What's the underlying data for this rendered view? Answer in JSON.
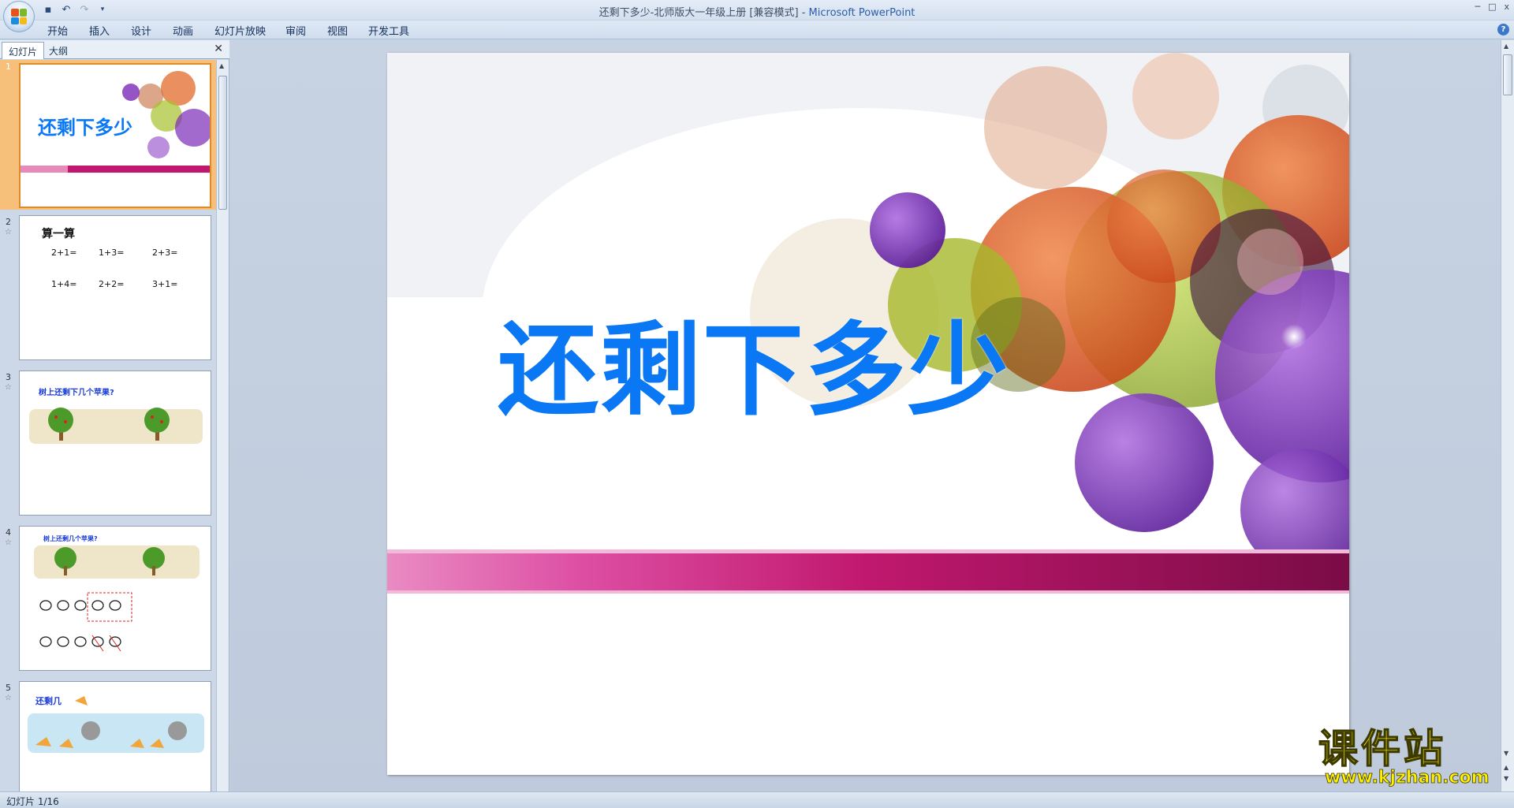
{
  "app": {
    "document_name": "还剩下多少-北师版大一年级上册 [兼容模式]",
    "separator": " - ",
    "app_name": "Microsoft PowerPoint"
  },
  "quick_access": {
    "icons": [
      "save-icon",
      "undo-icon",
      "redo-icon",
      "customize-icon"
    ]
  },
  "ribbon": {
    "tabs": [
      "开始",
      "插入",
      "设计",
      "动画",
      "幻灯片放映",
      "审阅",
      "视图",
      "开发工具"
    ]
  },
  "window_controls": {
    "minimize": "─",
    "maximize": "□",
    "close": "x"
  },
  "left_pane": {
    "tabs": [
      "幻灯片",
      "大纲"
    ],
    "close": "✕"
  },
  "thumbnails": [
    {
      "num": "1",
      "title": "还剩下多少"
    },
    {
      "num": "2",
      "heading": "算一算",
      "rows": [
        [
          "2+1=",
          "1+3=",
          "2+3="
        ],
        [
          "1+4=",
          "2+2=",
          "3+1="
        ]
      ]
    },
    {
      "num": "3",
      "question": "树上还剩下几个苹果?"
    },
    {
      "num": "4",
      "question": "树上还剩几个苹果?"
    },
    {
      "num": "5",
      "heading": "还剩几"
    }
  ],
  "main_slide": {
    "title": "还剩下多少"
  },
  "status": {
    "slide_counter": "幻灯片 1/16"
  },
  "watermark": {
    "title": "课件站",
    "url": "www.kjzhan.com"
  },
  "colors": {
    "title_blue": "#0a78f5",
    "magenta_band": "#c0186e",
    "accent_orange": "#e36a2a",
    "accent_purple": "#7a2bb8",
    "accent_green": "#a6c22c"
  }
}
